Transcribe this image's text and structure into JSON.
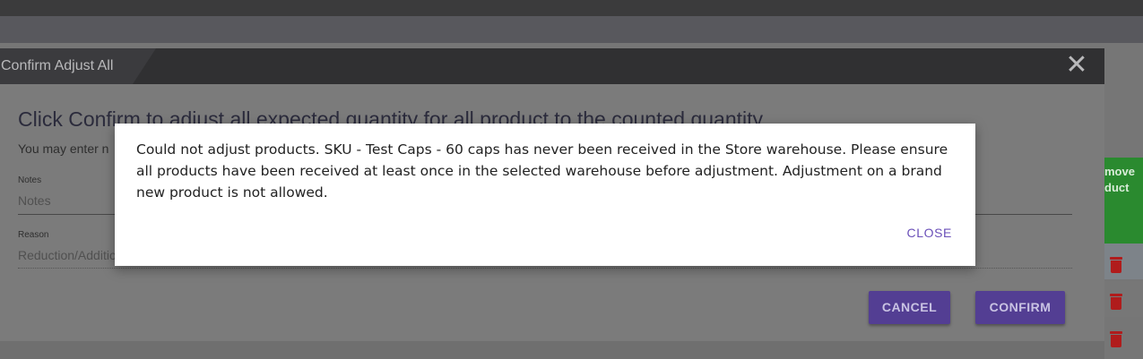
{
  "background": {
    "table_header_label": "move\nduct"
  },
  "dialog": {
    "title": "Confirm Adjust All",
    "close_symbol": "✕",
    "heading": "Click Confirm to adjust all expected quantity for all product to the counted quantity",
    "subtext": "You may enter n",
    "notes": {
      "label": "Notes",
      "placeholder": "Notes"
    },
    "reason": {
      "label": "Reason",
      "placeholder": "Reduction/Additio"
    },
    "cancel_label": "CANCEL",
    "confirm_label": "CONFIRM"
  },
  "alert": {
    "message": "Could not adjust products. SKU - Test Caps - 60 caps has never been received in the Store warehouse. Please ensure all products have been received at least once in the selected warehouse before adjustment. Adjustment on a brand new product is not allowed.",
    "close_label": "CLOSE"
  },
  "colors": {
    "accent": "#6a4fb8",
    "header_bg": "#303032",
    "action_green": "#2a8a2f",
    "delete_red": "#b01c1c"
  },
  "icons": [
    "close-icon",
    "trash-icon"
  ]
}
